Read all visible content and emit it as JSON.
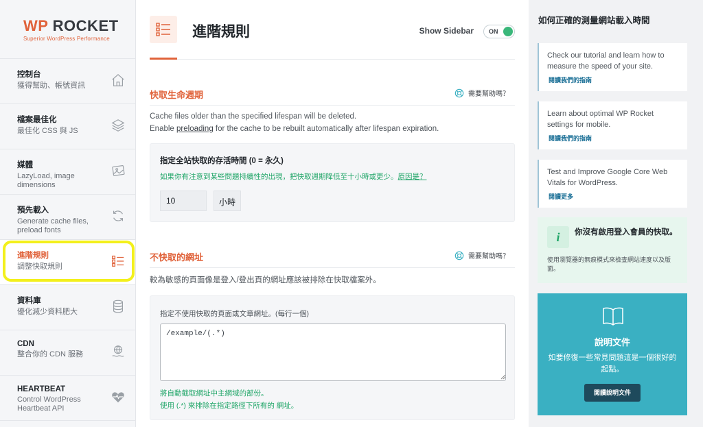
{
  "brand": {
    "wp": "WP",
    "rocket": "ROCKET",
    "tagline": "Superior WordPress Performance"
  },
  "sidebar": {
    "items": [
      {
        "title": "控制台",
        "sub": "獲得幫助、帳號資訊",
        "icon": "home-icon"
      },
      {
        "title": "檔案最佳化",
        "sub": "最佳化 CSS 與 JS",
        "icon": "layers-icon"
      },
      {
        "title": "媒體",
        "sub": "LazyLoad, image dimensions",
        "icon": "image-icon"
      },
      {
        "title": "預先載入",
        "sub": "Generate cache files, preload fonts",
        "icon": "refresh-icon"
      },
      {
        "title": "進階規則",
        "sub": "調整快取規則",
        "icon": "checklist-icon",
        "active": true
      },
      {
        "title": "資料庫",
        "sub": "優化減少資料肥大",
        "icon": "database-icon"
      },
      {
        "title": "CDN",
        "sub": "整合你的 CDN 服務",
        "icon": "cdn-icon"
      },
      {
        "title": "HEARTBEAT",
        "sub": "Control WordPress Heartbeat API",
        "icon": "heart-icon"
      }
    ]
  },
  "header": {
    "title": "進階規則",
    "show_sidebar_label": "Show Sidebar",
    "toggle_label": "ON",
    "toggle_on": true
  },
  "lifespan": {
    "title": "快取生命週期",
    "help": "需要幫助嗎？",
    "desc_line1": "Cache files older than the specified lifespan will be deleted.",
    "desc_pre": "Enable ",
    "desc_link": "preloading",
    "desc_post": " for the cache to be rebuilt automatically after lifespan expiration.",
    "field_label": "指定全站快取的存活時間 (0 = 永久)",
    "note": "如果你有注意到某些問題持續性的出現，把快取週期降低至十小時或更少。",
    "note_link": "原因是？",
    "value": "10",
    "unit": "小時"
  },
  "never_cache": {
    "title": "不快取的網址",
    "help": "需要幫助嗎？",
    "desc": "較為敏感的頁面像是登入/登出頁的網址應該被排除在快取檔案外。",
    "field_label": "指定不使用快取的頁面或文章網址。(每行一個)",
    "value": "/example/(.*)",
    "hint1": "將自動截取網址中主網域的部份。",
    "hint2": "使用 (.*) 來排除在指定路徑下所有的 網址。"
  },
  "right": {
    "title": "如何正確的測量網站載入時間",
    "cards": [
      {
        "text": "Check our tutorial and learn how to measure the speed of your site.",
        "link": "閱讀我們的指南"
      },
      {
        "text": "Learn about optimal WP Rocket settings for mobile.",
        "link": "閱讀我們的指南"
      },
      {
        "text": "Test and Improve Google Core Web Vitals for WordPress.",
        "link": "閱讀更多"
      }
    ],
    "tip_icon": "i",
    "tip_title": "你沒有啟用登入會員的快取。",
    "tip_sub": "使用瀏覽器的無痕模式來檢查網站速度以及版面。",
    "docs_title": "說明文件",
    "docs_sub": "如要修復一些常見問題這是一個很好的起點。",
    "docs_button": "閱讀說明文件"
  },
  "colors": {
    "accent": "#e0623a",
    "green": "#1fa567",
    "teal": "#3ab0c2",
    "highlight": "#f3f01c"
  }
}
